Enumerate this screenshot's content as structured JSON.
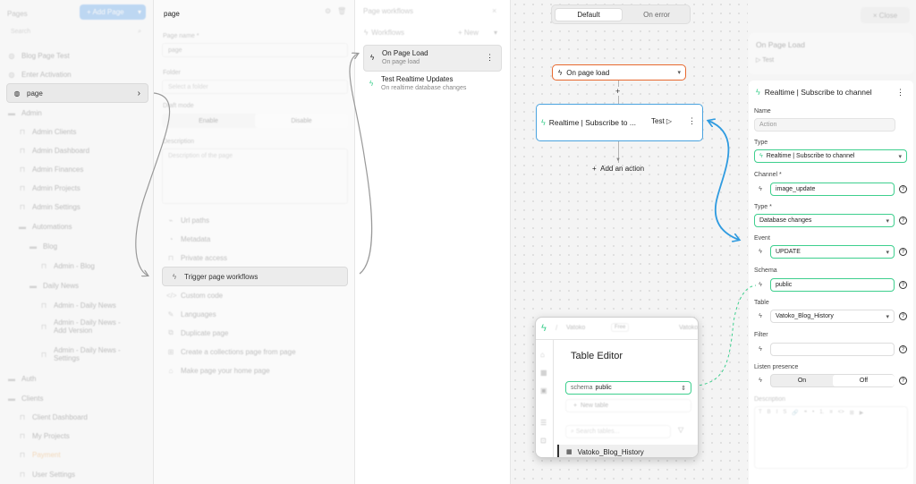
{
  "pages_panel": {
    "title": "Pages",
    "add_page_label": "+ Add Page",
    "search_placeholder": "Search",
    "items": [
      {
        "label": "Blog Page Test",
        "icon": "globe-icon"
      },
      {
        "label": "Enter Activation",
        "icon": "globe-icon"
      },
      {
        "label": "page",
        "icon": "globe-icon"
      },
      {
        "label": "Admin",
        "icon": "folder-icon"
      },
      {
        "label": "Admin Clients",
        "icon": "lock-icon"
      },
      {
        "label": "Admin Dashboard",
        "icon": "lock-icon"
      },
      {
        "label": "Admin Finances",
        "icon": "lock-icon"
      },
      {
        "label": "Admin Projects",
        "icon": "lock-icon"
      },
      {
        "label": "Admin Settings",
        "icon": "lock-icon"
      },
      {
        "label": "Automations",
        "icon": "folder-icon"
      },
      {
        "label": "Blog",
        "icon": "folder-icon"
      },
      {
        "label": "Admin - Blog",
        "icon": "lock-icon"
      },
      {
        "label": "Daily News",
        "icon": "folder-icon"
      },
      {
        "label": "Admin - Daily News",
        "icon": "lock-icon"
      },
      {
        "label": "Admin - Daily News - Add Version",
        "icon": "lock-icon"
      },
      {
        "label": "Admin - Daily News - Settings",
        "icon": "lock-icon"
      },
      {
        "label": "Auth",
        "icon": "folder-icon"
      },
      {
        "label": "Clients",
        "icon": "folder-icon"
      },
      {
        "label": "Client Dashboard",
        "icon": "lock-icon"
      },
      {
        "label": "My Projects",
        "icon": "lock-icon"
      },
      {
        "label": "Payment",
        "icon": "lock-icon"
      },
      {
        "label": "User Settings",
        "icon": "lock-icon"
      }
    ]
  },
  "page_settings": {
    "title": "page",
    "page_name_label": "Page name *",
    "page_name_value": "page",
    "folder_label": "Folder",
    "folder_placeholder": "Select a folder",
    "draft_mode_label": "Draft mode",
    "draft_enable": "Enable",
    "draft_disable": "Disable",
    "description_label": "Description",
    "description_placeholder": "Description of the page",
    "menu": [
      "Url paths",
      "Metadata",
      "Private access",
      "Trigger page workflows",
      "Custom code",
      "Languages",
      "Duplicate page",
      "Create a collections page from page",
      "Make page your home page"
    ]
  },
  "workflows_panel": {
    "title": "Page workflows",
    "workflows_label": "Workflows",
    "new_label": "+ New",
    "items": [
      {
        "title": "On Page Load",
        "subtitle": "On page load"
      },
      {
        "title": "Test Realtime Updates",
        "subtitle": "On realtime database changes"
      }
    ]
  },
  "canvas": {
    "tabs": [
      "Default",
      "On error"
    ],
    "trigger_label": "On page load",
    "action_title": "Realtime | Subscribe to ...",
    "test_label": "Test",
    "add_action_label": "Add an action"
  },
  "right_panel": {
    "close_label": "Close",
    "on_page_load_title": "On Page Load",
    "test_label": "Test",
    "action_title": "Realtime | Subscribe to channel",
    "name_label": "Name",
    "name_placeholder": "Action",
    "type_label": "Type",
    "type_value": "Realtime | Subscribe to channel",
    "channel_label": "Channel *",
    "channel_value": "image_update",
    "type2_label": "Type *",
    "type2_value": "Database changes",
    "event_label": "Event",
    "event_value": "UPDATE",
    "schema_label": "Schema",
    "schema_value": "public",
    "table_label": "Table",
    "table_value": "Vatoko_Blog_History",
    "filter_label": "Filter",
    "listen_label": "Listen presence",
    "listen_on": "On",
    "listen_off": "Off",
    "description_label": "Description",
    "toolbar": [
      "T",
      "B",
      "I",
      "S",
      "🔗",
      "❝",
      "•",
      "1.",
      "≡",
      "<>",
      "⊞",
      "▶"
    ]
  },
  "popup": {
    "brand": "Vatoko",
    "plan": "Free",
    "brand2": "Vatoko",
    "title": "Table Editor",
    "schema_label": "schema",
    "schema_value": "public",
    "new_table_label": "New table",
    "search_placeholder": "Search tables...",
    "table_name": "Vatoko_Blog_History"
  },
  "colors": {
    "accent_green": "#3ecf8e",
    "trigger_orange": "#e8692f",
    "select_blue": "#4aa3df",
    "arrow_blue": "#2f9be0"
  }
}
